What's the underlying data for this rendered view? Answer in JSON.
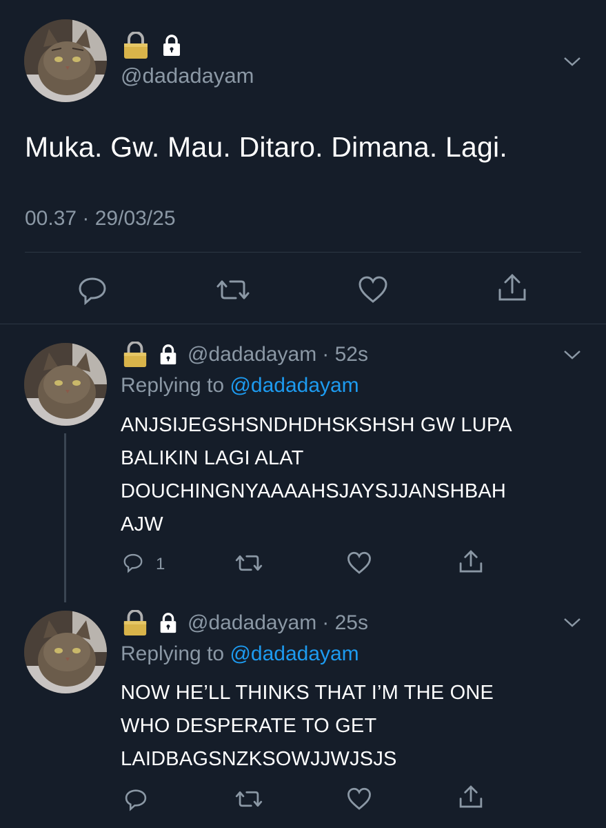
{
  "main_tweet": {
    "handle": "@dadadayam",
    "text": "Muka. Gw. Mau. Ditaro. Dimana. Lagi.",
    "timestamp": "00.37 · 29/03/25"
  },
  "replies": [
    {
      "handle": "@dadadayam",
      "time": "· 52s",
      "replying_prefix": "Replying to",
      "replying_handle": "@dadadayam",
      "text_lines": [
        "ANJSIJEGSHSNDHDHSKSHSH GW LUPA",
        "BALIKIN LAGI ALAT",
        "DOUCHINGNYAAAAHSJAYSJJANSHBAH",
        "AJW"
      ],
      "reply_count": "1"
    },
    {
      "handle": "@dadadayam",
      "time": "· 25s",
      "replying_prefix": "Replying to",
      "replying_handle": "@dadadayam",
      "text_lines": [
        "NOW HE’LL THINKS THAT I’M THE ONE",
        "WHO DESPERATE TO GET",
        "LAIDBAGSNZKSOWJJWJSJS"
      ]
    }
  ],
  "icons": [
    "cat-avatar",
    "gold-lock-icon",
    "lock-icon",
    "chevron-down-icon",
    "reply-icon",
    "retweet-icon",
    "like-icon",
    "share-icon"
  ],
  "colors": {
    "background": "#151d29",
    "text": "#ffffff",
    "muted": "#8b98a5",
    "link": "#1d9bf0",
    "lock_gold": "#d9b44a"
  }
}
